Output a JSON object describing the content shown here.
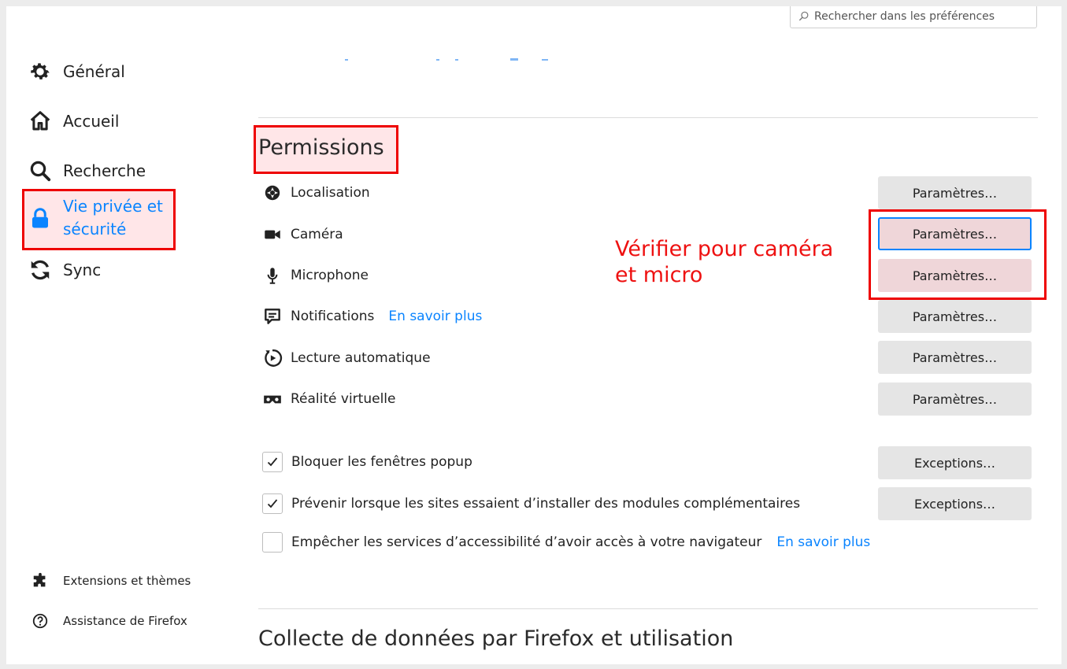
{
  "search": {
    "placeholder": "Rechercher dans les préférences"
  },
  "sidebar": {
    "items": [
      {
        "label": "Général",
        "icon": "gear-icon"
      },
      {
        "label": "Accueil",
        "icon": "home-icon"
      },
      {
        "label": "Recherche",
        "icon": "search-icon"
      },
      {
        "label_line1": "Vie privée et",
        "label_line2": "sécurité",
        "icon": "lock-icon",
        "selected": true
      },
      {
        "label": "Sync",
        "icon": "sync-icon"
      }
    ],
    "footer": [
      {
        "label": "Extensions et thèmes",
        "icon": "puzzle-icon"
      },
      {
        "label": "Assistance de Firefox",
        "icon": "help-icon"
      }
    ]
  },
  "permissions": {
    "title": "Permissions",
    "rows": [
      {
        "label": "Localisation",
        "icon": "location-icon",
        "button": "Paramètres…"
      },
      {
        "label": "Caméra",
        "icon": "camera-icon",
        "button": "Paramètres…"
      },
      {
        "label": "Microphone",
        "icon": "microphone-icon",
        "button": "Paramètres…"
      },
      {
        "label": "Notifications",
        "icon": "notification-icon",
        "learn_more": "En savoir plus",
        "button": "Paramètres…"
      },
      {
        "label": "Lecture automatique",
        "icon": "autoplay-icon",
        "button": "Paramètres…"
      },
      {
        "label": "Réalité virtuelle",
        "icon": "vr-icon",
        "button": "Paramètres…"
      }
    ],
    "checks": [
      {
        "label": "Bloquer les fenêtres popup",
        "checked": true,
        "button": "Exceptions…"
      },
      {
        "label": "Prévenir lorsque les sites essaient d’installer des modules complémentaires",
        "checked": true,
        "button": "Exceptions…"
      },
      {
        "label": "Empêcher les services d’accessibilité d’avoir accès à votre navigateur",
        "checked": false,
        "learn_more": "En savoir plus"
      }
    ]
  },
  "annotation": {
    "line1": "Vérifier pour caméra",
    "line2": "et micro",
    "color": "#ee1111"
  },
  "next_section": {
    "title": "Collecte de données par Firefox et utilisation"
  },
  "colors": {
    "accent": "#0a84ff",
    "highlight": "#ee0000"
  }
}
